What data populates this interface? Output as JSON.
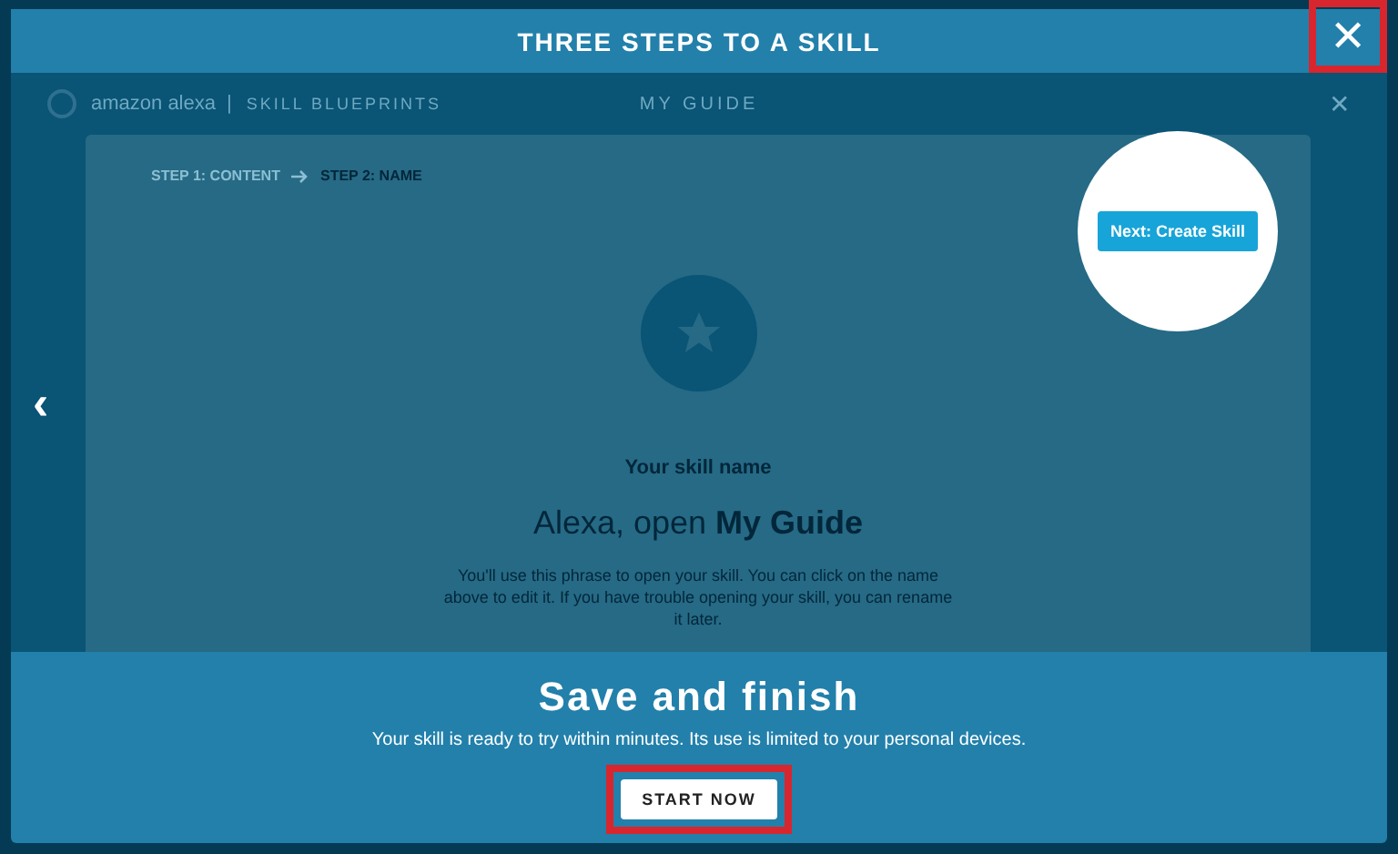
{
  "dialog": {
    "title": "THREE STEPS TO A SKILL",
    "close": {
      "label": "✕",
      "highlighted": true
    }
  },
  "background_page": {
    "brand": "amazon alexa",
    "separator": "|",
    "section": "SKILL BLUEPRINTS",
    "page_title": "MY GUIDE",
    "close": "✕",
    "steps": [
      {
        "label": "STEP 1: CONTENT",
        "selected": false
      },
      {
        "label": "STEP 2: NAME",
        "selected": true
      }
    ],
    "next_button": "Next: Create Skill",
    "name_label": "Your skill name",
    "invocation": "Alexa, open **My Guide**",
    "help": "You'll use this phrase to open your skill. You can click on the name above to edit it. If you have trouble opening your skill, you can rename it later."
  },
  "previous_arrow": "‹",
  "footer": {
    "title": "Save and finish",
    "text": "Your skill is ready to try within minutes. Its use is limited to your personal devices.",
    "button": {
      "label": "START NOW",
      "highlighted": true
    }
  }
}
